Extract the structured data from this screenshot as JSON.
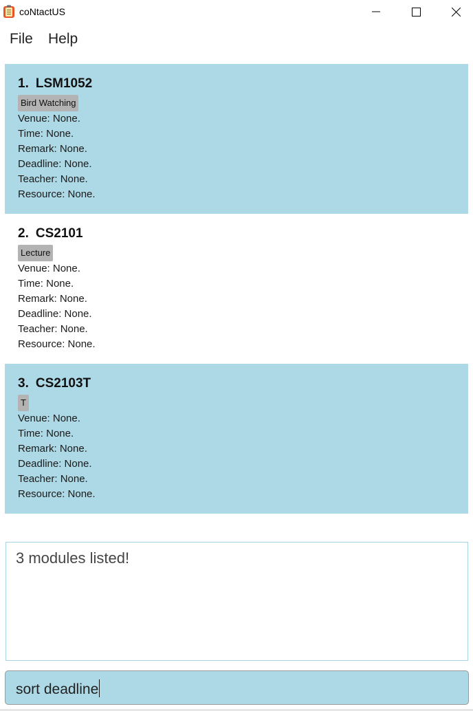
{
  "window": {
    "title": "coNtactUS",
    "icon": "notepad-app-icon",
    "controls": [
      "minimize-icon",
      "maximize-icon",
      "close-icon"
    ]
  },
  "menu": {
    "items": [
      {
        "label": "File"
      },
      {
        "label": "Help"
      }
    ]
  },
  "modules": [
    {
      "index": "1.",
      "code": "LSM1052",
      "tag": "Bird Watching",
      "venue": "Venue: None.",
      "time": "Time: None.",
      "remark": "Remark: None.",
      "deadline": "Deadline: None.",
      "teacher": "Teacher: None.",
      "resource": "Resource: None."
    },
    {
      "index": "2.",
      "code": "CS2101",
      "tag": "Lecture",
      "venue": "Venue: None.",
      "time": "Time: None.",
      "remark": "Remark: None.",
      "deadline": "Deadline: None.",
      "teacher": "Teacher: None.",
      "resource": "Resource: None."
    },
    {
      "index": "3.",
      "code": "CS2103T",
      "tag": "T",
      "venue": "Venue: None.",
      "time": "Time: None.",
      "remark": "Remark: None.",
      "deadline": "Deadline: None.",
      "teacher": "Teacher: None.",
      "resource": "Resource: None."
    }
  ],
  "result": {
    "message": "3 modules listed!"
  },
  "command": {
    "value": "sort deadline"
  },
  "colors": {
    "card_shaded": "#add8e5",
    "card_plain": "#ffffff",
    "tag_bg": "#b3b3b3",
    "command_bg": "#add8e5"
  }
}
